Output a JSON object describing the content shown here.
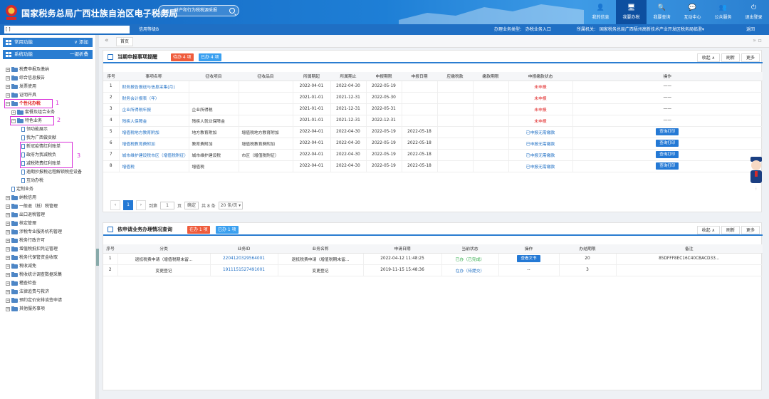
{
  "header": {
    "title": "国家税务总局广西壮族自治区电子税务局",
    "search_tag": "搜索：",
    "search_placeholder": "财产和行为税税源采报",
    "nav": [
      {
        "label": "我的信息",
        "icon": "user-icon"
      },
      {
        "label": "我要办税",
        "icon": "monitor-icon"
      },
      {
        "label": "我要查询",
        "icon": "search-icon"
      },
      {
        "label": "互动中心",
        "icon": "chat-icon"
      },
      {
        "label": "公众服务",
        "icon": "people-icon"
      },
      {
        "label": "退出登录",
        "icon": "power-icon"
      }
    ]
  },
  "subbar": {
    "left": "[                                                   ]",
    "level": "信用等级B",
    "biz_label": "办理业务类型：  办税业务入口",
    "tax_label": "所属机关：  国家税务总局广西梧州高新技术产业开发区税务局临澄▾",
    "return": "返回"
  },
  "sidebar": {
    "common": "常用功能",
    "common_action": "∨  添加",
    "system": "系统功能",
    "system_action": "一键折叠",
    "items": [
      "税费申报及缴纳",
      "综合信息报告",
      "发票使用",
      "证明开具",
      "个性化办税",
      "套餐及组合业务",
      "特色业务",
      "领功能展示",
      "我为广西做贡献",
      "新冠疫情红利账单",
      "政府为我减税负",
      "减税降费红利账单",
      "逾期抄报税远程解锁税控设备",
      "互动办税",
      "定制业务",
      "纳税信用",
      "一般退（抵）税管理",
      "出口退税管理",
      "核定管理",
      "涉税专业服务机构管理",
      "税务行政许可",
      "增值税抵扣凭证管理",
      "税务代保管资金收取",
      "税收减免",
      "税收统计调查数据采集",
      "稽查检查",
      "法律追责与救济",
      "预约定价安排谈签申请",
      "其他服务事项"
    ],
    "annotations": [
      "1",
      "2",
      "3"
    ]
  },
  "tabs": {
    "home": "首页"
  },
  "panel1": {
    "title": "当期申报事项提醒",
    "badge_todo": "待办 4 项",
    "badge_done": "已办 4 项",
    "btn_collapse": "收起 ∧",
    "btn_refresh": "刷新",
    "btn_more": "更多",
    "columns": [
      "序号",
      "事项名称",
      "征收项目",
      "征收品目",
      "所属期起",
      "所属期止",
      "申报期限",
      "申报日期",
      "应缴税款",
      "缴款期限",
      "申报缴款状态",
      "操作"
    ],
    "rows": [
      [
        "1",
        "财务报告报送与信息采集(月)",
        "",
        "",
        "2022-04-01",
        "2022-04-30",
        "2022-05-19",
        "",
        "",
        "",
        "未申报",
        "——"
      ],
      [
        "2",
        "财务会计报表（年）",
        "",
        "",
        "2021-01-01",
        "2021-12-31",
        "2022-05-30",
        "",
        "",
        "",
        "未申报",
        "——"
      ],
      [
        "3",
        "企业所得税年报",
        "企业所得税",
        "",
        "2021-01-01",
        "2021-12-31",
        "2022-05-31",
        "",
        "",
        "",
        "未申报",
        "——"
      ],
      [
        "4",
        "残疾人保障金",
        "残疾人就业保障金",
        "",
        "2021-01-01",
        "2021-12-31",
        "2022-12-31",
        "",
        "",
        "",
        "未申报",
        "——"
      ],
      [
        "5",
        "增值税地方教育附加",
        "地方教育附加",
        "增值税地方教育附加",
        "2022-04-01",
        "2022-04-30",
        "2022-05-19",
        "2022-05-18",
        "",
        "",
        "已申报无需缴款",
        "查询打印"
      ],
      [
        "6",
        "增值税教育费附加",
        "教育费附加",
        "增值税教育费附加",
        "2022-04-01",
        "2022-04-30",
        "2022-05-19",
        "2022-05-18",
        "",
        "",
        "已申报无需缴款",
        "查询打印"
      ],
      [
        "7",
        "城市维护建设税市区（增值税附征）",
        "城市维护建设税",
        "市区（增值税附征）",
        "2022-04-01",
        "2022-04-30",
        "2022-05-19",
        "2022-05-18",
        "",
        "",
        "已申报无需缴款",
        "查询打印"
      ],
      [
        "8",
        "增值税",
        "增值税",
        "",
        "2022-04-01",
        "2022-04-30",
        "2022-05-19",
        "2022-05-18",
        "",
        "",
        "已申报无需缴款",
        "查询打印"
      ]
    ],
    "pager": {
      "prev": "‹",
      "current": "1",
      "next": "›",
      "goto": "到第",
      "page_input": "1",
      "page_unit": "页",
      "confirm": "确定",
      "total": "共 8 条",
      "per_page": "20 条/页 ▾"
    }
  },
  "panel2": {
    "title": "依申请业务办理情况查询",
    "badge_todo": "在办 1 项",
    "badge_done": "已办 1 项",
    "btn_collapse": "收起 ∧",
    "btn_refresh": "刷新",
    "btn_more": "更多",
    "columns": [
      "序号",
      "分类",
      "业务ID",
      "业务名称",
      "申请日期",
      "当前状态",
      "操作",
      "办结期限",
      "备注"
    ],
    "rows": [
      [
        "1",
        "退抵税费申请（增值税期末留...",
        "2204120329564001",
        "退抵税费申请（增值税期末留...",
        "2022-04-12 11:48:25",
        "已办（已完成）",
        "查看文书",
        "20",
        "85DFFF8EC16C40CBACD33..."
      ],
      [
        "2",
        "变更登记",
        "1911151527491001",
        "变更登记",
        "2019-11-15 15:48:36",
        "在办（待提交）",
        "--",
        "3",
        ""
      ]
    ]
  }
}
